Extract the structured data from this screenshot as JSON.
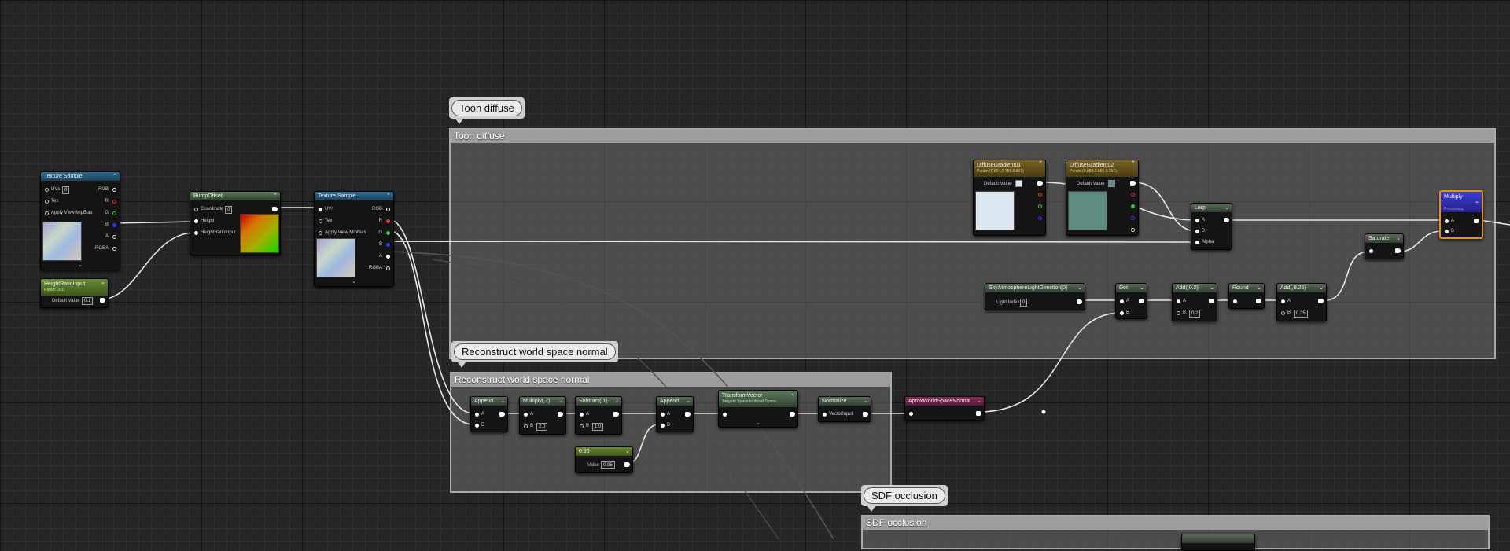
{
  "comments": {
    "toon": {
      "bubble": "Toon diffuse",
      "header": "Toon diffuse"
    },
    "reconstruct": {
      "bubble": "Reconstruct world space normal",
      "header": "Reconstruct world space normal"
    },
    "sdf": {
      "bubble": "SDF occlusion",
      "header": "SDF occlusion"
    }
  },
  "nodes": {
    "texture_sample_1": {
      "title": "Texture Sample",
      "uvs": "UVs",
      "uvs_value": "0",
      "tex": "Tex",
      "apply_mip": "Apply View MipBias",
      "rgb": "RGB",
      "r": "R",
      "g": "G",
      "b": "B",
      "a": "A",
      "rgba": "RGBA"
    },
    "height_ratio_input": {
      "title": "HeightRatioInput",
      "subtitle": "Param (0.1)",
      "default_label": "Default Value",
      "default_value": "0.1"
    },
    "bump_offset": {
      "title": "BumpOffset",
      "coordinate": "Coordinate",
      "coordinate_value": "0",
      "height": "Height",
      "height_ratio_input": "HeightRatioInput"
    },
    "texture_sample_2": {
      "title": "Texture Sample",
      "uvs": "UVs",
      "tex": "Tex",
      "apply_mip": "Apply View MipBias",
      "rgb": "RGB",
      "r": "R",
      "g": "G",
      "b": "B",
      "a": "A",
      "rgba": "RGBA"
    },
    "diffuse_gradient_1": {
      "title": "DiffuseGradient01",
      "subtitle": "Param (0.834,0.789,0.801)",
      "default_label": "Default Value"
    },
    "diffuse_gradient_2": {
      "title": "DiffuseGradient02",
      "subtitle": "Param (0.089,0.556,0.151)",
      "default_label": "Default Value"
    },
    "lerp": {
      "title": "Lerp",
      "a": "A",
      "b": "B",
      "alpha": "Alpha"
    },
    "multiply_main": {
      "title": "Multiply",
      "subtitle": "Processing",
      "a": "A",
      "b": "B"
    },
    "saturate": {
      "title": "Saturate"
    },
    "sky_light_dir": {
      "title": "SkyAtmosphereLightDirection[0]",
      "light_index_label": "Light Index",
      "light_index_value": "0"
    },
    "dot": {
      "title": "Dot",
      "a": "A",
      "b": "B"
    },
    "add_02": {
      "title": "Add(,0.2)",
      "a": "A",
      "b": "B",
      "b_value": "0.2"
    },
    "round": {
      "title": "Round"
    },
    "add_025": {
      "title": "Add(,0.25)",
      "a": "A",
      "b": "B",
      "b_value": "0.25"
    },
    "append_1": {
      "title": "Append",
      "a": "A",
      "b": "B"
    },
    "multiply_2": {
      "title": "Multiply(,2)",
      "a": "A",
      "b": "B",
      "b_value": "2.0"
    },
    "subtract_1": {
      "title": "Subtract(,1)",
      "a": "A",
      "b": "B",
      "b_value": "1.0"
    },
    "append_2": {
      "title": "Append",
      "a": "A",
      "b": "B"
    },
    "transform_vector": {
      "title": "TransformVector",
      "subtitle": "Tangent Space to World Space"
    },
    "normalize": {
      "title": "Normalize",
      "vector_input": "VectorInput"
    },
    "approx_normal": {
      "title": "AproxWorldSpaceNormal"
    },
    "const_095": {
      "title": "0.95",
      "value_label": "Value",
      "value": "0.95"
    }
  },
  "colors": {
    "gradient1_preview": "#dde8f2",
    "gradient2_preview": "#5f8c82",
    "multiply_highlight": "#e0921c"
  }
}
